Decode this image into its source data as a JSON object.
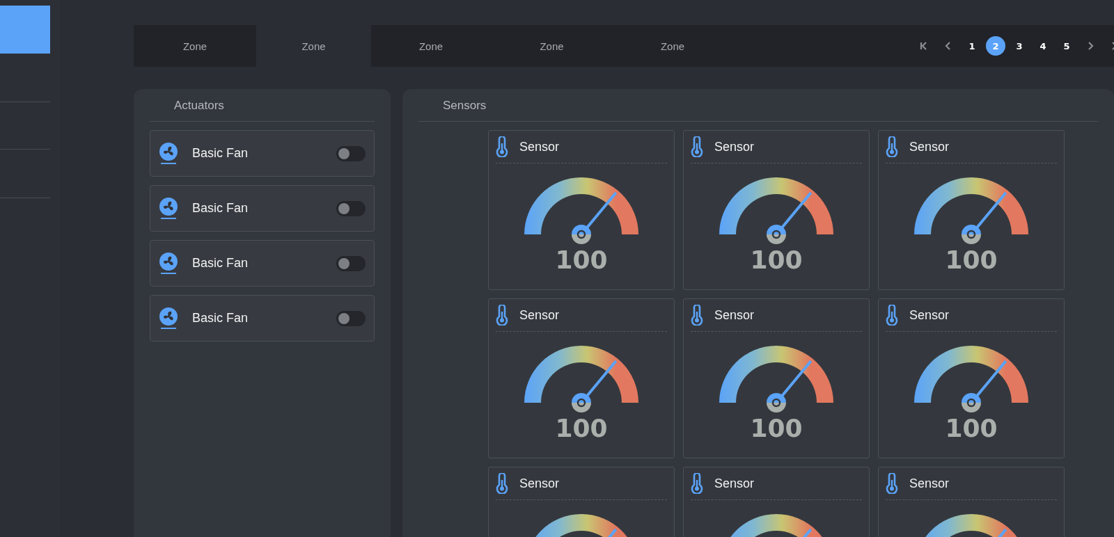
{
  "tabs": [
    {
      "label": "Zone",
      "selected": false
    },
    {
      "label": "Zone",
      "selected": true
    },
    {
      "label": "Zone",
      "selected": false
    },
    {
      "label": "Zone",
      "selected": false
    },
    {
      "label": "Zone",
      "selected": false
    }
  ],
  "pagination": {
    "pages": [
      {
        "label": "1",
        "selected": false
      },
      {
        "label": "2",
        "selected": true
      },
      {
        "label": "3",
        "selected": false
      },
      {
        "label": "4",
        "selected": false
      },
      {
        "label": "5",
        "selected": false
      }
    ]
  },
  "actuators": {
    "title": "Actuators",
    "items": [
      {
        "name": "Basic Fan",
        "on": false
      },
      {
        "name": "Basic Fan",
        "on": false
      },
      {
        "name": "Basic Fan",
        "on": false
      },
      {
        "name": "Basic Fan",
        "on": false
      }
    ]
  },
  "sensors": {
    "title": "Sensors",
    "items": [
      {
        "name": "Sensor",
        "value": "100"
      },
      {
        "name": "Sensor",
        "value": "100"
      },
      {
        "name": "Sensor",
        "value": "100"
      },
      {
        "name": "Sensor",
        "value": "100"
      },
      {
        "name": "Sensor",
        "value": "100"
      },
      {
        "name": "Sensor",
        "value": "100"
      },
      {
        "name": "Sensor"
      },
      {
        "name": "Sensor"
      },
      {
        "name": "Sensor"
      }
    ]
  }
}
